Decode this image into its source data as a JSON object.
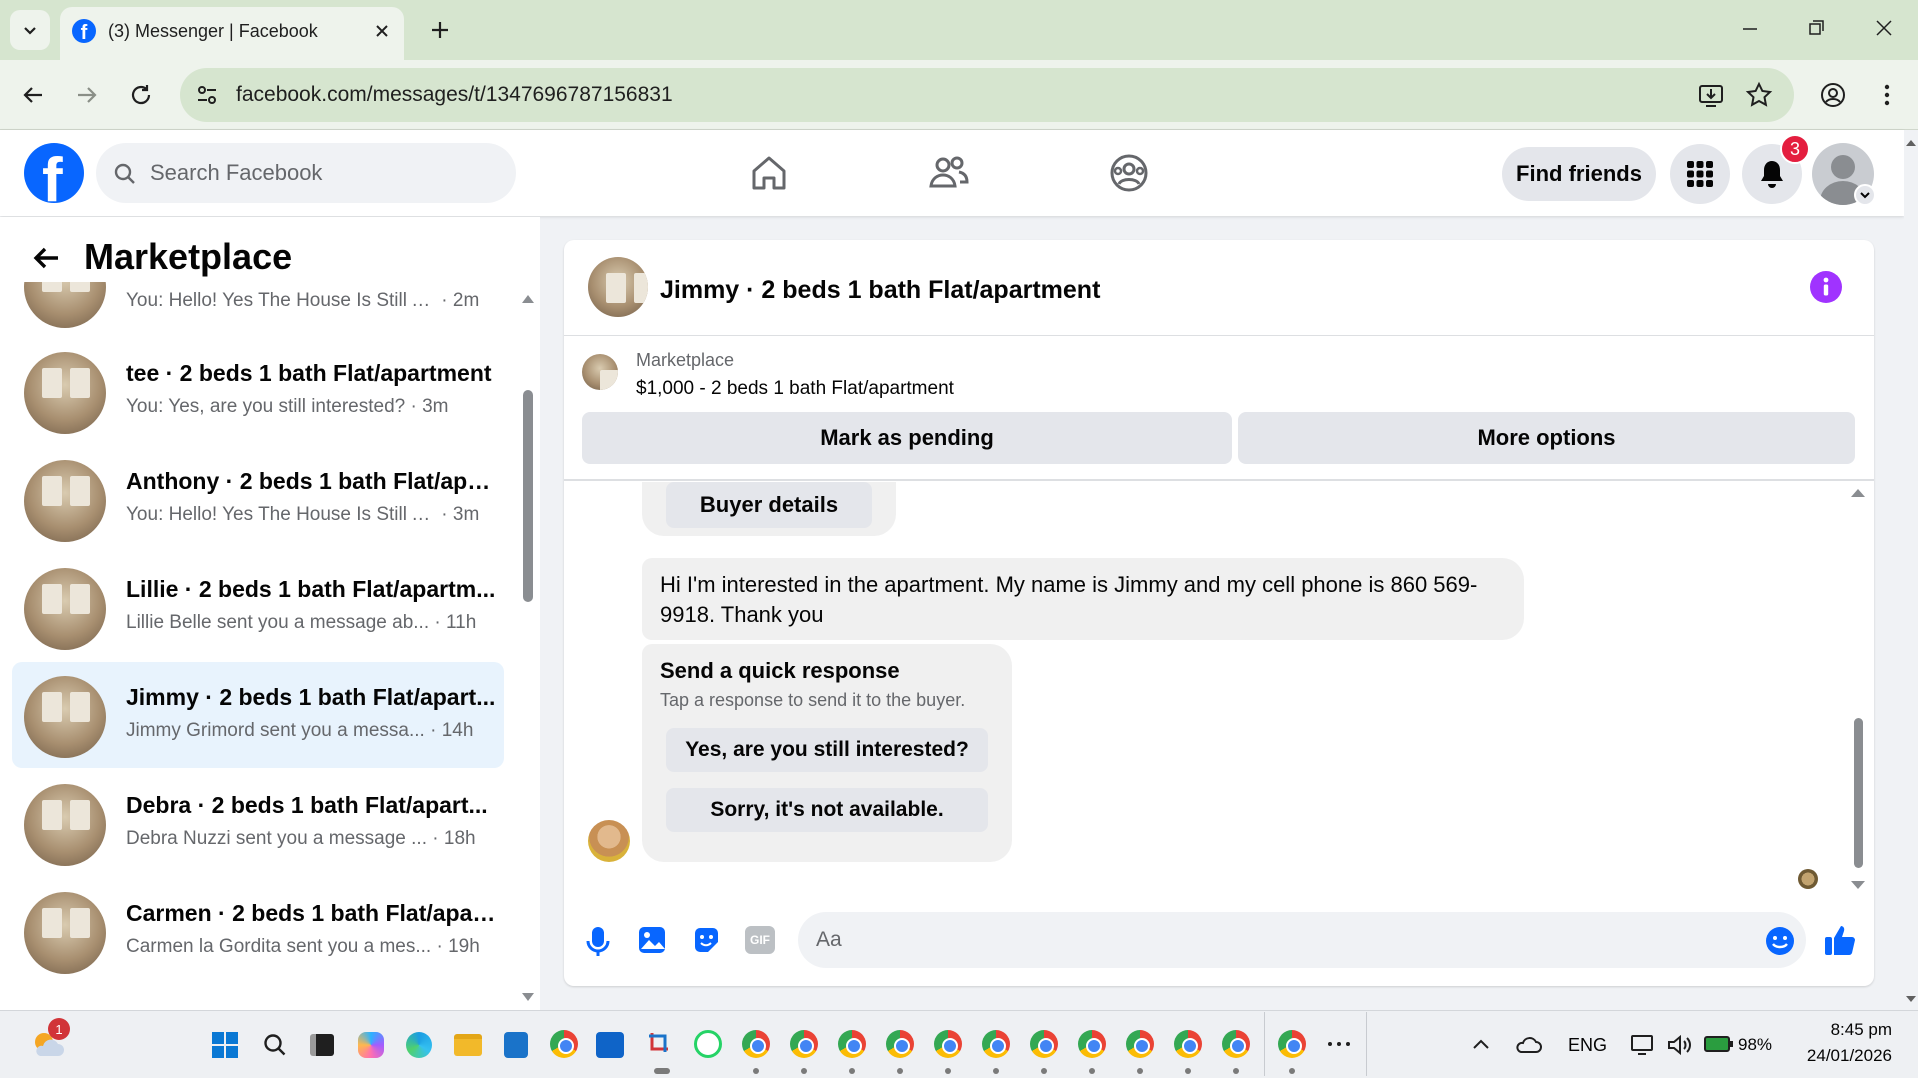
{
  "browser": {
    "tab_title": "(3) Messenger | Facebook",
    "url": "facebook.com/messages/t/1347696787156831"
  },
  "header": {
    "search_placeholder": "Search Facebook",
    "find_friends": "Find friends",
    "notification_count": "3"
  },
  "sidebar": {
    "title": "Marketplace",
    "conversations": [
      {
        "title": "",
        "preview": "You: Hello! Yes The House Is Still A...",
        "time": "2m"
      },
      {
        "title": "tee · 2 beds 1 bath Flat/apartment",
        "preview": "You: Yes, are you still interested?",
        "time": "3m"
      },
      {
        "title": "Anthony · 2 beds 1 bath Flat/apa...",
        "preview": "You: Hello! Yes The House Is Still A...",
        "time": "3m"
      },
      {
        "title": "Lillie · 2 beds 1 bath Flat/apartm...",
        "preview": "Lillie Belle sent you a message ab...",
        "time": "11h"
      },
      {
        "title": "Jimmy · 2 beds 1 bath Flat/apart...",
        "preview": "Jimmy Grimord sent you a messa...",
        "time": "14h"
      },
      {
        "title": "Debra · 2 beds 1 bath Flat/apart...",
        "preview": "Debra Nuzzi sent you a message ...",
        "time": "18h"
      },
      {
        "title": "Carmen · 2 beds 1 bath Flat/apar...",
        "preview": "Carmen la Gordita sent you a mes...",
        "time": "19h"
      }
    ]
  },
  "chat": {
    "title": "Jimmy · 2 beds 1 bath Flat/apartment",
    "listing_source": "Marketplace",
    "listing": "$1,000 - 2 beds 1 bath Flat/apartment",
    "mark_pending": "Mark as pending",
    "more_options": "More options",
    "buyer_details": "Buyer details",
    "message": "Hi I'm interested in the apartment. My name is Jimmy and my cell phone is 860 569-9918. Thank you",
    "quick_title": "Send a quick response",
    "quick_sub": "Tap a response to send it to the buyer.",
    "quick_1": "Yes, are you still interested?",
    "quick_2": "Sorry, it's not available.",
    "composer_placeholder": "Aa"
  },
  "taskbar": {
    "weather_badge": "1",
    "language": "ENG",
    "battery": "98%",
    "time": "8:45 pm",
    "date": "24/01/2026"
  },
  "colors": {
    "fb_blue": "#0866ff",
    "notif_red": "#e41e3f",
    "info_purple": "#a033ff",
    "active_row": "#e8f3fd"
  }
}
